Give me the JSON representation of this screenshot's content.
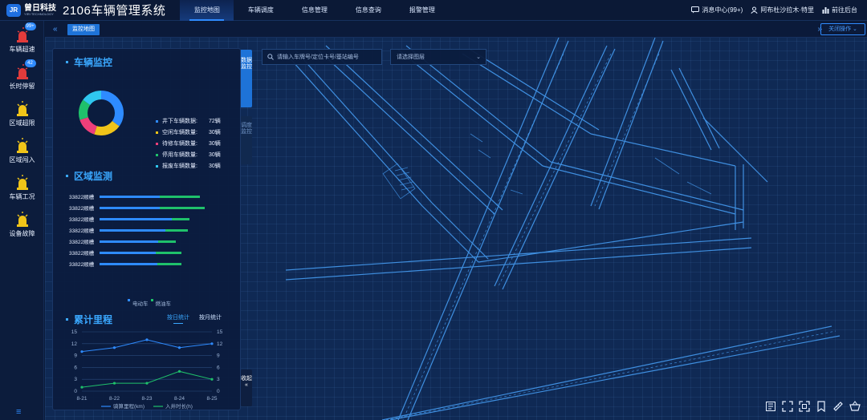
{
  "header": {
    "logo_mark": "JR",
    "logo_cn": "曾日科技",
    "logo_en": "YIRI TECHNOLOGY",
    "app_title": "2106车辆管理系统",
    "nav": [
      {
        "label": "监控地图"
      },
      {
        "label": "车辆调度"
      },
      {
        "label": "信息管理"
      },
      {
        "label": "信息查询"
      },
      {
        "label": "报警管理"
      }
    ],
    "messages": "消息中心(99+)",
    "user": "阿布杜沙拉木·特里",
    "backend": "前往后台"
  },
  "sidebar": {
    "items": [
      {
        "label": "车辆超速",
        "badge": "99+",
        "color": "#e23b3b"
      },
      {
        "label": "长时停留",
        "badge": "42",
        "color": "#e23b3b"
      },
      {
        "label": "区域超限",
        "badge": "",
        "color": "#f0c419"
      },
      {
        "label": "区域闯入",
        "badge": "",
        "color": "#f0c419"
      },
      {
        "label": "车辆工况",
        "badge": "",
        "color": "#f0c419"
      },
      {
        "label": "设备故障",
        "badge": "",
        "color": "#f0c419"
      }
    ]
  },
  "crumb": {
    "tab": "监控地图",
    "close_ops": "关闭操作"
  },
  "vehicle_monitor": {
    "title": "车辆监控",
    "items": [
      {
        "label": "井下车辆数据:",
        "value": "72辆",
        "color": "#2e8bff"
      },
      {
        "label": "空闲车辆数量:",
        "value": "30辆",
        "color": "#f0c419"
      },
      {
        "label": "待修车辆数量:",
        "value": "30辆",
        "color": "#ee3f7a"
      },
      {
        "label": "停用车辆数量:",
        "value": "30辆",
        "color": "#1fc16b"
      },
      {
        "label": "报废车辆数量:",
        "value": "30辆",
        "color": "#2fc7f0"
      }
    ]
  },
  "region_monitor": {
    "title": "区域监测",
    "rows": [
      {
        "name": "33822顺槽",
        "electric": 75,
        "fuel": 50
      },
      {
        "name": "33822顺槽",
        "electric": 75,
        "fuel": 56
      },
      {
        "name": "33822顺槽",
        "electric": 90,
        "fuel": 22
      },
      {
        "name": "33822顺槽",
        "electric": 82,
        "fuel": 28
      },
      {
        "name": "33822顺槽",
        "electric": 73,
        "fuel": 22
      },
      {
        "name": "33822顺槽",
        "electric": 70,
        "fuel": 32
      },
      {
        "name": "33822顺槽",
        "electric": 72,
        "fuel": 30
      }
    ],
    "legend": [
      "电动车",
      "燃油车"
    ]
  },
  "mileage": {
    "title": "累计里程",
    "tabs": [
      "按日统计",
      "按月统计"
    ]
  },
  "chart_data": {
    "type": "line",
    "x": [
      "8-21",
      "8-22",
      "8-23",
      "8-24",
      "8-25"
    ],
    "ylim": [
      0,
      15
    ],
    "yticks": [
      0,
      3,
      6,
      9,
      12,
      15
    ],
    "grid": true,
    "legend_position": "bottom",
    "series": [
      {
        "name": "骑算里程(km)",
        "values": [
          10,
          11,
          13,
          11,
          12
        ],
        "color": "#2e8bff"
      },
      {
        "name": "入井时长(h)",
        "values": [
          1,
          2,
          2,
          5,
          3
        ],
        "color": "#1fc16b"
      }
    ]
  },
  "side_tabs": [
    "数据监控",
    "调度监控",
    "收起"
  ],
  "search": {
    "placeholder": "请输入车牌号/定位卡号/基站编号"
  },
  "layer": {
    "placeholder": "请选择图层"
  },
  "tools": [
    "ranging-icon",
    "fullscreen-icon",
    "fit-view-icon",
    "bookmark-icon",
    "ruler-icon",
    "basket-icon"
  ]
}
